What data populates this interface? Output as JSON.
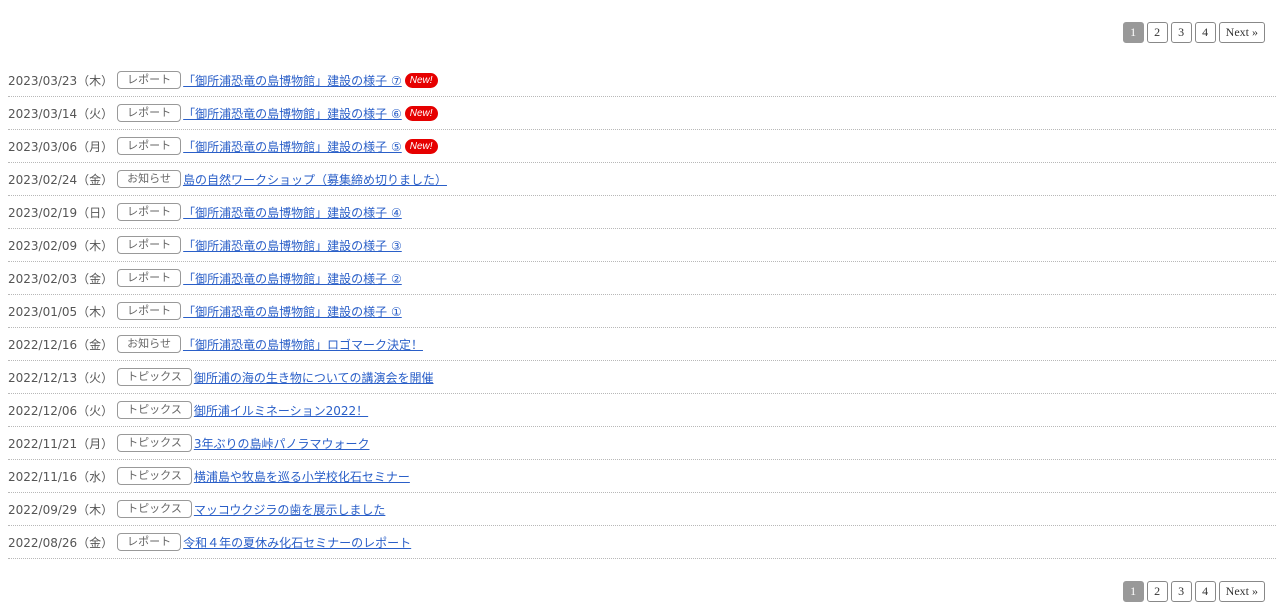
{
  "pagination": {
    "pages": [
      "1",
      "2",
      "3",
      "4"
    ],
    "current": "1",
    "next_label": "Next »"
  },
  "colors": {
    "link": "#2a5fc8",
    "new_badge": "#e60000",
    "current_page": "#999999"
  },
  "news": [
    {
      "date": "2023/03/23（木）",
      "category": "レポート",
      "title": "「御所浦恐竜の島博物館」建設の様子 ⑦",
      "badge": "New!"
    },
    {
      "date": "2023/03/14（火）",
      "category": "レポート",
      "title": "「御所浦恐竜の島博物館」建設の様子 ⑥",
      "badge": "New!"
    },
    {
      "date": "2023/03/06（月）",
      "category": "レポート",
      "title": "「御所浦恐竜の島博物館」建設の様子 ⑤",
      "badge": "New!"
    },
    {
      "date": "2023/02/24（金）",
      "category": "お知らせ",
      "title": "島の自然ワークショップ（募集締め切りました）",
      "badge": ""
    },
    {
      "date": "2023/02/19（日）",
      "category": "レポート",
      "title": "「御所浦恐竜の島博物館」建設の様子 ④",
      "badge": ""
    },
    {
      "date": "2023/02/09（木）",
      "category": "レポート",
      "title": "「御所浦恐竜の島博物館」建設の様子 ③",
      "badge": ""
    },
    {
      "date": "2023/02/03（金）",
      "category": "レポート",
      "title": "「御所浦恐竜の島博物館」建設の様子 ②",
      "badge": ""
    },
    {
      "date": "2023/01/05（木）",
      "category": "レポート",
      "title": "「御所浦恐竜の島博物館」建設の様子 ①",
      "badge": ""
    },
    {
      "date": "2022/12/16（金）",
      "category": "お知らせ",
      "title": "「御所浦恐竜の島博物館」ロゴマーク決定！",
      "badge": ""
    },
    {
      "date": "2022/12/13（火）",
      "category": "トピックス",
      "title": "御所浦の海の生き物についての講演会を開催",
      "badge": ""
    },
    {
      "date": "2022/12/06（火）",
      "category": "トピックス",
      "title": "御所浦イルミネーション2022！",
      "badge": ""
    },
    {
      "date": "2022/11/21（月）",
      "category": "トピックス",
      "title": "3年ぶりの島峠パノラマウォーク",
      "badge": ""
    },
    {
      "date": "2022/11/16（水）",
      "category": "トピックス",
      "title": "横浦島や牧島を巡る小学校化石セミナー",
      "badge": ""
    },
    {
      "date": "2022/09/29（木）",
      "category": "トピックス",
      "title": "マッコウクジラの歯を展示しました",
      "badge": ""
    },
    {
      "date": "2022/08/26（金）",
      "category": "レポート",
      "title": "令和４年の夏休み化石セミナーのレポート",
      "badge": ""
    }
  ]
}
